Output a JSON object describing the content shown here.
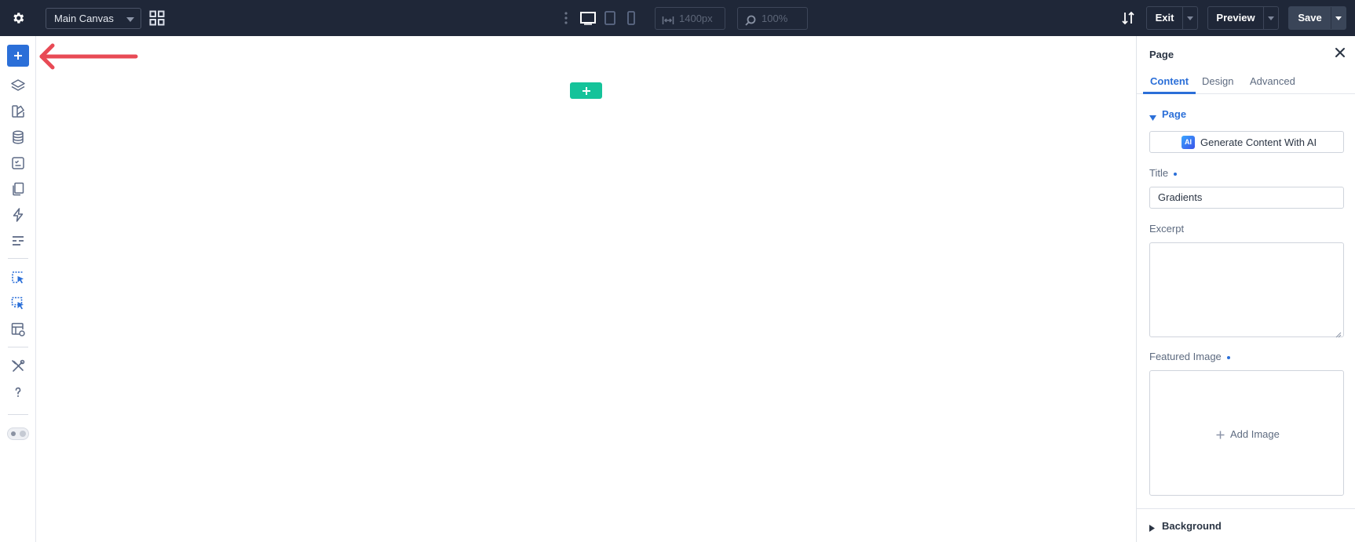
{
  "topbar": {
    "canvas_select": "Main Canvas",
    "width_value": "1400px",
    "zoom_value": "100%",
    "exit_label": "Exit",
    "preview_label": "Preview",
    "save_label": "Save",
    "background_color": "#1f2738"
  },
  "sidebar": {
    "items": [
      {
        "icon": "plus-icon",
        "active": true
      },
      {
        "icon": "layers-icon"
      },
      {
        "icon": "style-icon"
      },
      {
        "icon": "database-icon"
      },
      {
        "icon": "template-icon"
      },
      {
        "icon": "pages-icon"
      },
      {
        "icon": "lightning-icon"
      },
      {
        "icon": "settings-sliders-icon"
      },
      {
        "icon": "select-element-icon"
      },
      {
        "icon": "select-multiple-icon"
      },
      {
        "icon": "layout-settings-icon"
      },
      {
        "icon": "tools-icon"
      },
      {
        "icon": "help-icon"
      },
      {
        "icon": "theme-toggle-icon"
      }
    ]
  },
  "canvas": {
    "annotation": "red-arrow-pointing-left",
    "add_section_color": "#15c39a"
  },
  "panel": {
    "title": "Page",
    "tabs": [
      {
        "label": "Content",
        "active": true
      },
      {
        "label": "Design"
      },
      {
        "label": "Advanced"
      }
    ],
    "section_page": "Page",
    "ai_badge": "AI",
    "ai_button_label": "Generate Content With AI",
    "title_label": "Title",
    "title_value": "Gradients",
    "excerpt_label": "Excerpt",
    "excerpt_value": "",
    "featured_image_label": "Featured Image",
    "add_image_label": "Add Image",
    "section_background": "Background",
    "accent_color": "#2b6fd8"
  }
}
